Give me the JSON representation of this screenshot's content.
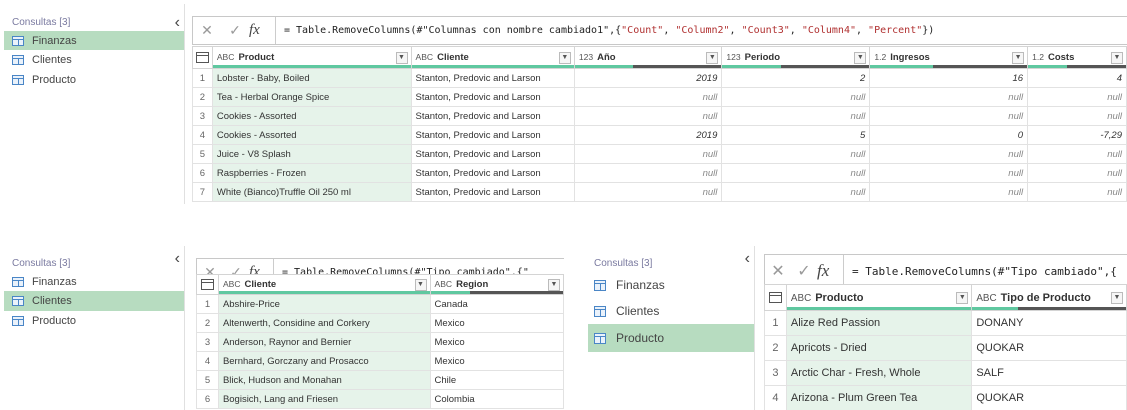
{
  "panel1": {
    "consultas_label": "Consultas [3]",
    "queries": [
      {
        "label": "Finanzas",
        "selected": true
      },
      {
        "label": "Clientes",
        "selected": false
      },
      {
        "label": "Producto",
        "selected": false
      }
    ],
    "formula_prefix": "= Table.RemoveColumns(#\"Columnas con nombre cambiado1\",{",
    "formula_strings": [
      "\"Count\"",
      "\"Column2\"",
      "\"Count3\"",
      "\"Column4\"",
      "\"Percent\""
    ],
    "formula_suffix": "})",
    "columns": [
      {
        "type": "ABC",
        "name": "Product"
      },
      {
        "type": "ABC",
        "name": "Cliente"
      },
      {
        "type": "123",
        "name": "Año"
      },
      {
        "type": "123",
        "name": "Periodo"
      },
      {
        "type": "1.2",
        "name": "Ingresos"
      },
      {
        "type": "1.2",
        "name": "Costs"
      }
    ],
    "rows": [
      [
        "1",
        "Lobster - Baby, Boiled",
        "Stanton, Predovic and Larson",
        "2019",
        "2",
        "16",
        "4"
      ],
      [
        "2",
        "Tea - Herbal Orange Spice",
        "Stanton, Predovic and Larson",
        "null",
        "null",
        "null",
        "null"
      ],
      [
        "3",
        "Cookies - Assorted",
        "Stanton, Predovic and Larson",
        "null",
        "null",
        "null",
        "null"
      ],
      [
        "4",
        "Cookies - Assorted",
        "Stanton, Predovic and Larson",
        "2019",
        "5",
        "0",
        "-7,29"
      ],
      [
        "5",
        "Juice - V8 Splash",
        "Stanton, Predovic and Larson",
        "null",
        "null",
        "null",
        "null"
      ],
      [
        "6",
        "Raspberries - Frozen",
        "Stanton, Predovic and Larson",
        "null",
        "null",
        "null",
        "null"
      ],
      [
        "7",
        "White (Bianco)Truffle Oil 250 ml",
        "Stanton, Predovic and Larson",
        "null",
        "null",
        "null",
        "null"
      ]
    ]
  },
  "panel2": {
    "consultas_label": "Consultas [3]",
    "queries": [
      {
        "label": "Finanzas",
        "selected": false
      },
      {
        "label": "Clientes",
        "selected": true
      },
      {
        "label": "Producto",
        "selected": false
      }
    ],
    "formula": "= Table.RemoveColumns(#\"Tipo cambiado\",{\"",
    "columns": [
      {
        "type": "ABC",
        "name": "Cliente"
      },
      {
        "type": "ABC",
        "name": "Region"
      }
    ],
    "rows": [
      [
        "1",
        "Abshire-Price",
        "Canada"
      ],
      [
        "2",
        "Altenwerth, Considine and Corkery",
        "Mexico"
      ],
      [
        "3",
        "Anderson, Raynor and Bernier",
        "Mexico"
      ],
      [
        "4",
        "Bernhard, Gorczany and Prosacco",
        "Mexico"
      ],
      [
        "5",
        "Blick, Hudson and Monahan",
        "Chile"
      ],
      [
        "6",
        "Bogisich, Lang and Friesen",
        "Colombia"
      ]
    ]
  },
  "panel3": {
    "consultas_label": "Consultas [3]",
    "queries": [
      {
        "label": "Finanzas",
        "selected": false
      },
      {
        "label": "Clientes",
        "selected": false
      },
      {
        "label": "Producto",
        "selected": true
      }
    ],
    "formula": "= Table.RemoveColumns(#\"Tipo cambiado\",{",
    "columns": [
      {
        "type": "ABC",
        "name": "Producto"
      },
      {
        "type": "ABC",
        "name": "Tipo de Producto"
      }
    ],
    "rows": [
      [
        "1",
        "Alize Red Passion",
        "DONANY"
      ],
      [
        "2",
        "Apricots - Dried",
        "QUOKAR"
      ],
      [
        "3",
        "Arctic Char - Fresh, Whole",
        "SALF"
      ],
      [
        "4",
        "Arizona - Plum Green Tea",
        "QUOKAR"
      ]
    ]
  },
  "icons": {
    "cancel": "✕",
    "confirm": "✓",
    "fx": "fx",
    "collapse": "‹",
    "dropdown": "▼"
  }
}
